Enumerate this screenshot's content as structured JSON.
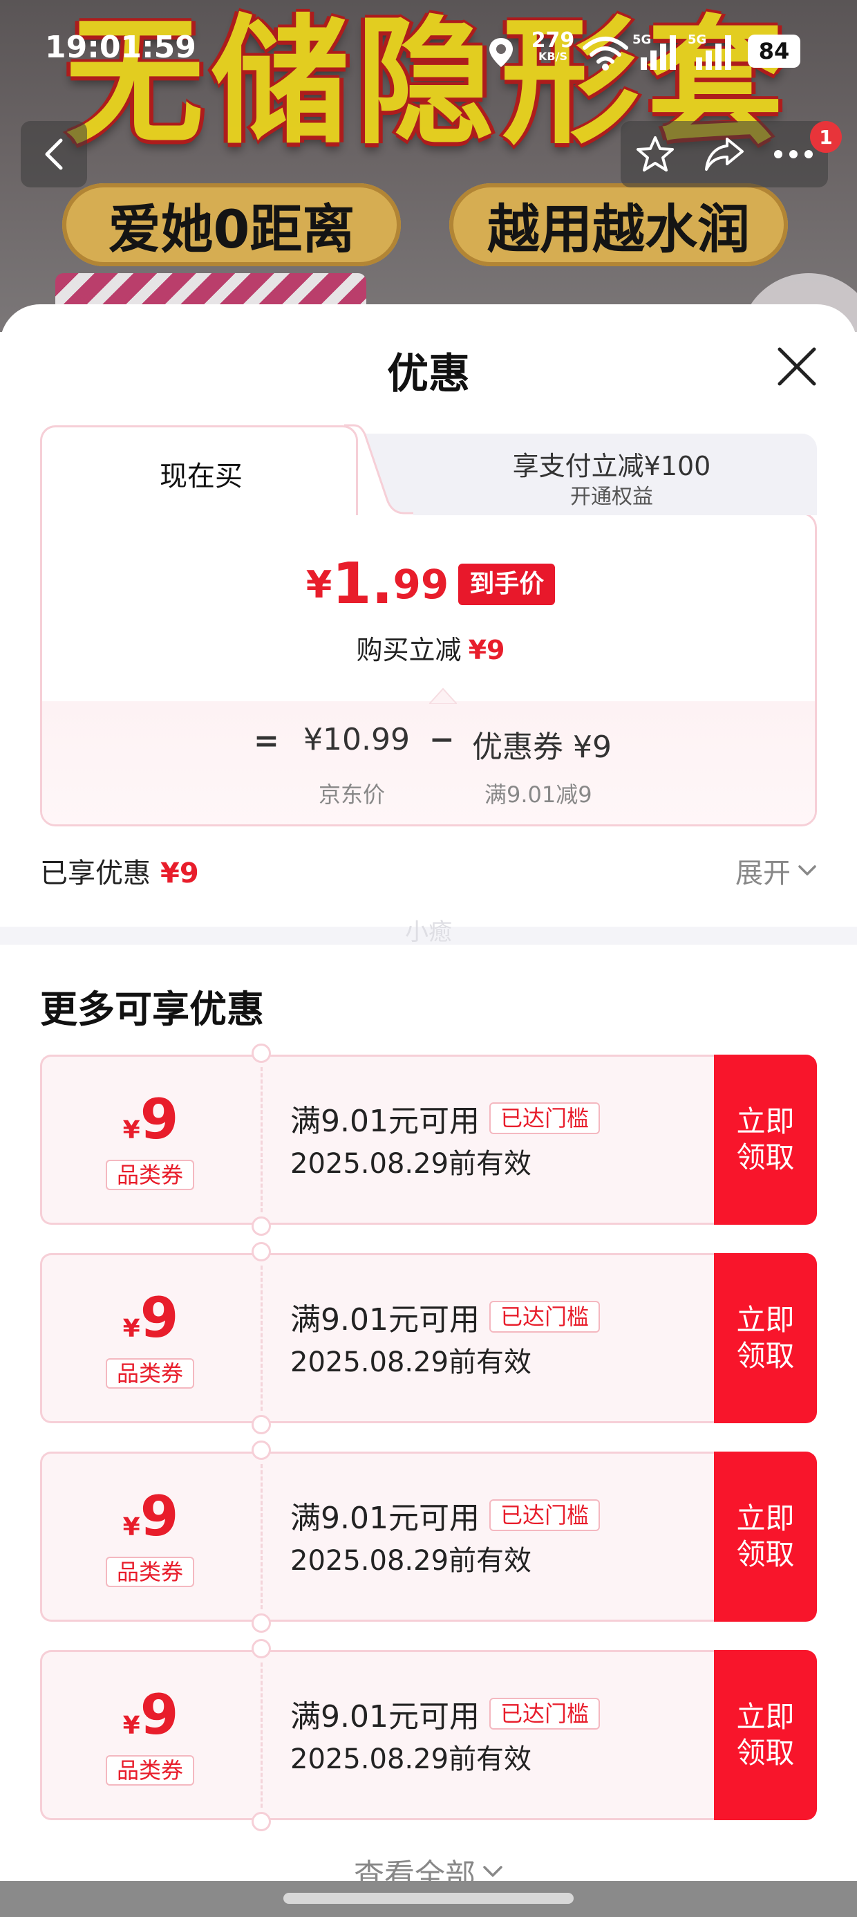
{
  "status_bar": {
    "time": "19:01:59",
    "net_speed": "279",
    "net_unit": "KB/S",
    "sig1_label": "5G",
    "sig2_label": "5G",
    "battery": "84"
  },
  "banner": {
    "title": "无储隐形套",
    "pill_left": "爱她0距离",
    "pill_right": "越用越水润"
  },
  "nav": {
    "badge": "1"
  },
  "sheet": {
    "title": "优惠"
  },
  "price_card": {
    "tab_now": "现在买",
    "tab_pay_line1": "享支付立减¥100",
    "tab_pay_line2": "开通权益",
    "final_price_symbol": "¥",
    "final_price_int": "1.",
    "final_price_dec": "99",
    "final_price_tag": "到手价",
    "buy_cut_label": "购买立减",
    "buy_cut_amount": "¥9",
    "calc_eq": "=",
    "jd_price": "¥10.99",
    "calc_minus": "−",
    "coupon_part": "优惠券 ¥9",
    "jd_price_label": "京东价",
    "coupon_rule": "满9.01减9"
  },
  "enjoyed": {
    "label": "已享优惠",
    "amount": "¥9",
    "expand": "展开"
  },
  "watermark": "小癒",
  "more": {
    "title": "更多可享优惠",
    "coupons": [
      {
        "symbol": "¥",
        "amount": "9",
        "type": "品类券",
        "condition": "满9.01元可用",
        "status": "已达门槛",
        "valid": "2025.08.29前有效",
        "claim_line1": "立即",
        "claim_line2": "领取"
      },
      {
        "symbol": "¥",
        "amount": "9",
        "type": "品类券",
        "condition": "满9.01元可用",
        "status": "已达门槛",
        "valid": "2025.08.29前有效",
        "claim_line1": "立即",
        "claim_line2": "领取"
      },
      {
        "symbol": "¥",
        "amount": "9",
        "type": "品类券",
        "condition": "满9.01元可用",
        "status": "已达门槛",
        "valid": "2025.08.29前有效",
        "claim_line1": "立即",
        "claim_line2": "领取"
      },
      {
        "symbol": "¥",
        "amount": "9",
        "type": "品类券",
        "condition": "满9.01元可用",
        "status": "已达门槛",
        "valid": "2025.08.29前有效",
        "claim_line1": "立即",
        "claim_line2": "领取"
      }
    ],
    "view_all": "查看全部"
  }
}
